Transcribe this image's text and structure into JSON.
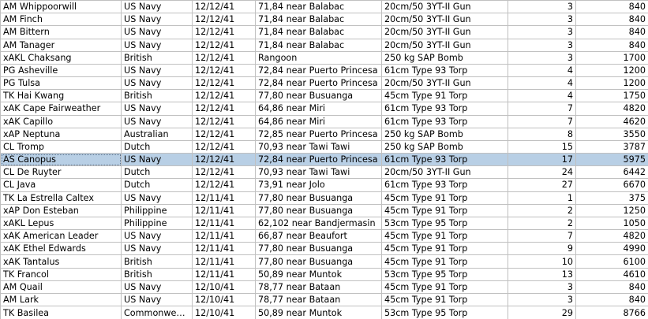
{
  "table": {
    "selected_index": 12,
    "rows": [
      [
        "AM Whippoorwill",
        "US Navy",
        "12/12/41",
        "71,84 near Balabac",
        "20cm/50 3YT-II Gun",
        "3",
        "840"
      ],
      [
        "AM Finch",
        "US Navy",
        "12/12/41",
        "71,84 near Balabac",
        "20cm/50 3YT-II Gun",
        "3",
        "840"
      ],
      [
        "AM Bittern",
        "US Navy",
        "12/12/41",
        "71,84 near Balabac",
        "20cm/50 3YT-II Gun",
        "3",
        "840"
      ],
      [
        "AM Tanager",
        "US Navy",
        "12/12/41",
        "71,84 near Balabac",
        "20cm/50 3YT-II Gun",
        "3",
        "840"
      ],
      [
        "xAKL Chaksang",
        "British",
        "12/12/41",
        "Rangoon",
        "250 kg SAP Bomb",
        "3",
        "1700"
      ],
      [
        "PG Asheville",
        "US Navy",
        "12/12/41",
        "72,84 near Puerto Princesa",
        "61cm Type 93 Torp",
        "4",
        "1200"
      ],
      [
        "PG Tulsa",
        "US Navy",
        "12/12/41",
        "72,84 near Puerto Princesa",
        "20cm/50 3YT-II Gun",
        "4",
        "1200"
      ],
      [
        "TK Hai Kwang",
        "British",
        "12/12/41",
        "77,80 near Busuanga",
        "45cm Type 91 Torp",
        "4",
        "1750"
      ],
      [
        "xAK Cape Fairweather",
        "US Navy",
        "12/12/41",
        "64,86 near Miri",
        "61cm Type 93 Torp",
        "7",
        "4820"
      ],
      [
        "xAK Capillo",
        "US Navy",
        "12/12/41",
        "64,86 near Miri",
        "61cm Type 93 Torp",
        "7",
        "4620"
      ],
      [
        "xAP Neptuna",
        "Australian",
        "12/12/41",
        "72,85 near Puerto Princesa",
        "250 kg SAP Bomb",
        "8",
        "3550"
      ],
      [
        "CL Tromp",
        "Dutch",
        "12/12/41",
        "70,93 near Tawi Tawi",
        "250 kg SAP Bomb",
        "15",
        "3787"
      ],
      [
        "AS Canopus",
        "US Navy",
        "12/12/41",
        "72,84 near Puerto Princesa",
        "61cm Type 93 Torp",
        "17",
        "5975"
      ],
      [
        "CL De Ruyter",
        "Dutch",
        "12/12/41",
        "70,93 near Tawi Tawi",
        "20cm/50 3YT-II Gun",
        "24",
        "6442"
      ],
      [
        "CL Java",
        "Dutch",
        "12/12/41",
        "73,91 near Jolo",
        "61cm Type 93 Torp",
        "27",
        "6670"
      ],
      [
        "TK La Estrella Caltex",
        "US Navy",
        "12/11/41",
        "77,80 near Busuanga",
        "45cm Type 91 Torp",
        "1",
        "375"
      ],
      [
        "xAP Don Esteban",
        "Philippine",
        "12/11/41",
        "77,80 near Busuanga",
        "45cm Type 91 Torp",
        "2",
        "1250"
      ],
      [
        "xAKL Lepus",
        "Philippine",
        "12/11/41",
        "62,102 near Bandjermasin",
        "53cm Type 95 Torp",
        "2",
        "1050"
      ],
      [
        "xAK American Leader",
        "US Navy",
        "12/11/41",
        "66,87 near Beaufort",
        "45cm Type 91 Torp",
        "7",
        "4820"
      ],
      [
        "xAK Ethel Edwards",
        "US Navy",
        "12/11/41",
        "77,80 near Busuanga",
        "45cm Type 91 Torp",
        "9",
        "4990"
      ],
      [
        "xAK Tantalus",
        "British",
        "12/11/41",
        "77,80 near Busuanga",
        "45cm Type 91 Torp",
        "10",
        "6100"
      ],
      [
        "TK Francol",
        "British",
        "12/11/41",
        "50,89 near Muntok",
        "53cm Type 95 Torp",
        "13",
        "4610"
      ],
      [
        "AM Quail",
        "US Navy",
        "12/10/41",
        "78,77 near Bataan",
        "45cm Type 91 Torp",
        "3",
        "840"
      ],
      [
        "AM Lark",
        "US Navy",
        "12/10/41",
        "78,77 near Bataan",
        "45cm Type 91 Torp",
        "3",
        "840"
      ],
      [
        "TK Basilea",
        "Commonweal...",
        "12/10/41",
        "50,89 near Muntok",
        "53cm Type 95 Torp",
        "29",
        "8766"
      ]
    ]
  }
}
